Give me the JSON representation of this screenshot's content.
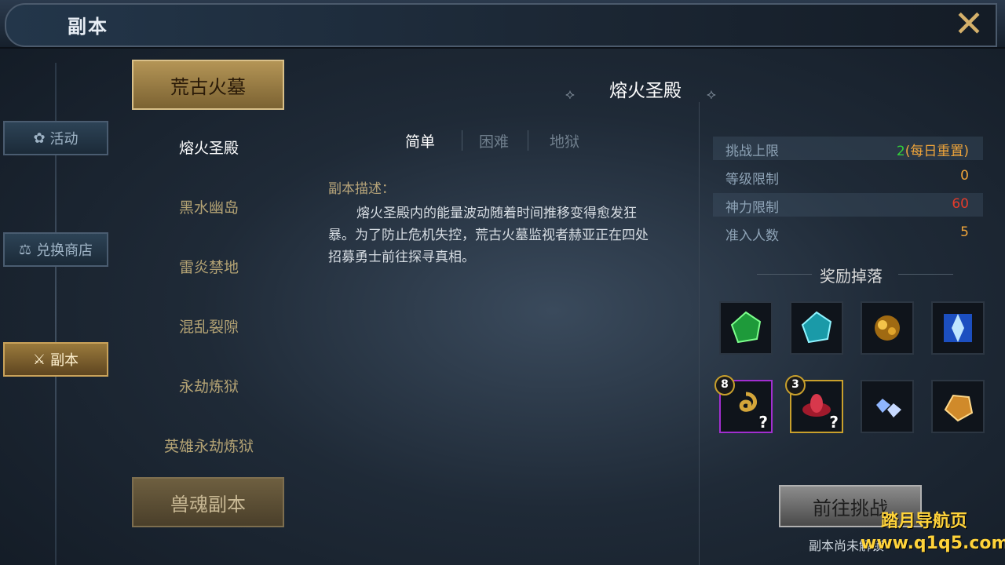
{
  "header": {
    "title": "副本",
    "close_label": "✕"
  },
  "side_tabs": [
    {
      "label": "活动",
      "icon": "flower-icon"
    },
    {
      "label": "兑换商店",
      "icon": "scale-icon"
    },
    {
      "label": "副本",
      "icon": "crossed-swords-icon",
      "active": true
    }
  ],
  "dungeon_list": {
    "category_active": "荒古火墓",
    "items": [
      "熔火圣殿",
      "黑水幽岛",
      "雷炎禁地",
      "混乱裂隙",
      "永劫炼狱",
      "英雄永劫炼狱"
    ],
    "category_next": "兽魂副本"
  },
  "detail": {
    "title": "熔火圣殿",
    "difficulties": [
      "简单",
      "困难",
      "地狱"
    ],
    "desc_label": "副本描述：",
    "desc_text": "熔火圣殿内的能量波动随着时间推移变得愈发狂暴。为了防止危机失控，荒古火墓监视者赫亚正在四处招募勇士前往探寻真相。"
  },
  "stats": [
    {
      "label": "挑战上限",
      "value": "2",
      "suffix": "(每日重置)"
    },
    {
      "label": "等级限制",
      "value": "0"
    },
    {
      "label": "神力限制",
      "value": "60"
    },
    {
      "label": "准入人数",
      "value": "5"
    }
  ],
  "rewards": {
    "title": "奖励掉落",
    "items": [
      {
        "icon": "green-gem-icon"
      },
      {
        "icon": "cyan-gem-icon"
      },
      {
        "icon": "gold-ore-icon"
      },
      {
        "icon": "ice-crystal-icon"
      },
      {
        "icon": "gold-swirl-icon",
        "count": "8",
        "mystery": "?"
      },
      {
        "icon": "red-lotus-icon",
        "count": "3",
        "mystery": "?"
      },
      {
        "icon": "diamond-icon"
      },
      {
        "icon": "amber-stone-icon"
      }
    ]
  },
  "actions": {
    "go_label": "前往挑战",
    "locked_note": "副本尚未解锁"
  },
  "watermark": {
    "line1": "踏月导航页",
    "line2": "www.q1q5.com"
  },
  "colors": {
    "gold": "#d9c089",
    "green": "#33d13a",
    "orange": "#f0a53a",
    "red": "#e53b2a"
  }
}
